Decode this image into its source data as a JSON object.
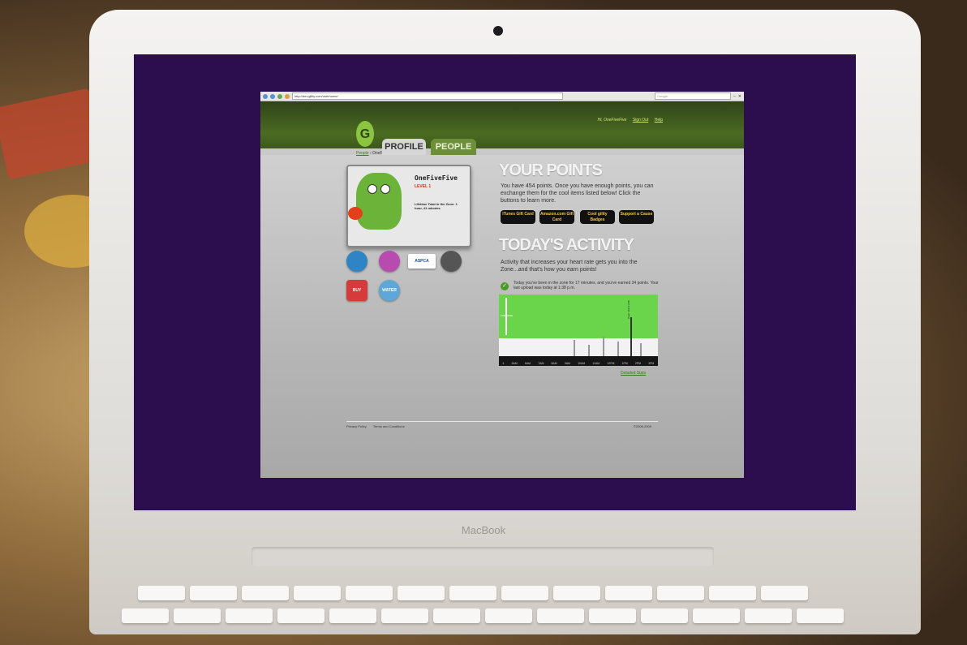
{
  "device": {
    "brand": "MacBook"
  },
  "browser": {
    "url": "http://dev.gility.com/userhome/",
    "search_placeholder": "Google"
  },
  "header": {
    "greeting": "Hi, OneFiveFive",
    "sign_out": "Sign Out",
    "help": "Help",
    "logo_letter": "G"
  },
  "tabs": [
    {
      "label": "PROFILE",
      "active": true
    },
    {
      "label": "PEOPLE",
      "active": false
    }
  ],
  "breadcrumb": {
    "link": "People",
    "separator": "›",
    "current": "OneFiveFive"
  },
  "profile": {
    "name": "OneFiveFive",
    "level": "LEVEL 1",
    "lifetime": "Lifetime Total in the Zone: 1 hour, 41 minutes"
  },
  "badges": [
    "ASPCA",
    "BUY",
    "WATER"
  ],
  "points": {
    "title": "YOUR POINTS",
    "text": "You have 454 points. Once you have enough points, you can exchange them for the cool items listed below! Click the buttons to learn more.",
    "buttons": [
      "iTunes Gift Card",
      "Amazon.com Gift Card",
      "Cool gility Badges",
      "Support a Cause"
    ]
  },
  "activity": {
    "title": "TODAY'S ACTIVITY",
    "text": "Activity that increases your heart rate gets you into the Zone...and that's how you earn points!",
    "status": "Today you've been in the zone for 17 minutes, and you've earned 34 points. Your last upload was today at 1:38 p.m.",
    "zone_label": "THE ZONE",
    "max_label": "Peak: 460 4:3:58",
    "ticks": [
      "4",
      "5AM",
      "6AM",
      "7AM",
      "8AM",
      "9AM",
      "10AM",
      "11AM",
      "12PM",
      "1PM",
      "2PM",
      "3PM"
    ],
    "detailed_link": "Detailed Stats"
  },
  "footer": {
    "links": [
      "Privacy Policy",
      "Terms and Conditions"
    ],
    "copyright": "©2008-2009"
  },
  "colors": {
    "screen": "#2c0e4e",
    "header_green": "#4b6b22",
    "zone_green": "#6ad44a",
    "button_text": "#f5c64a"
  }
}
